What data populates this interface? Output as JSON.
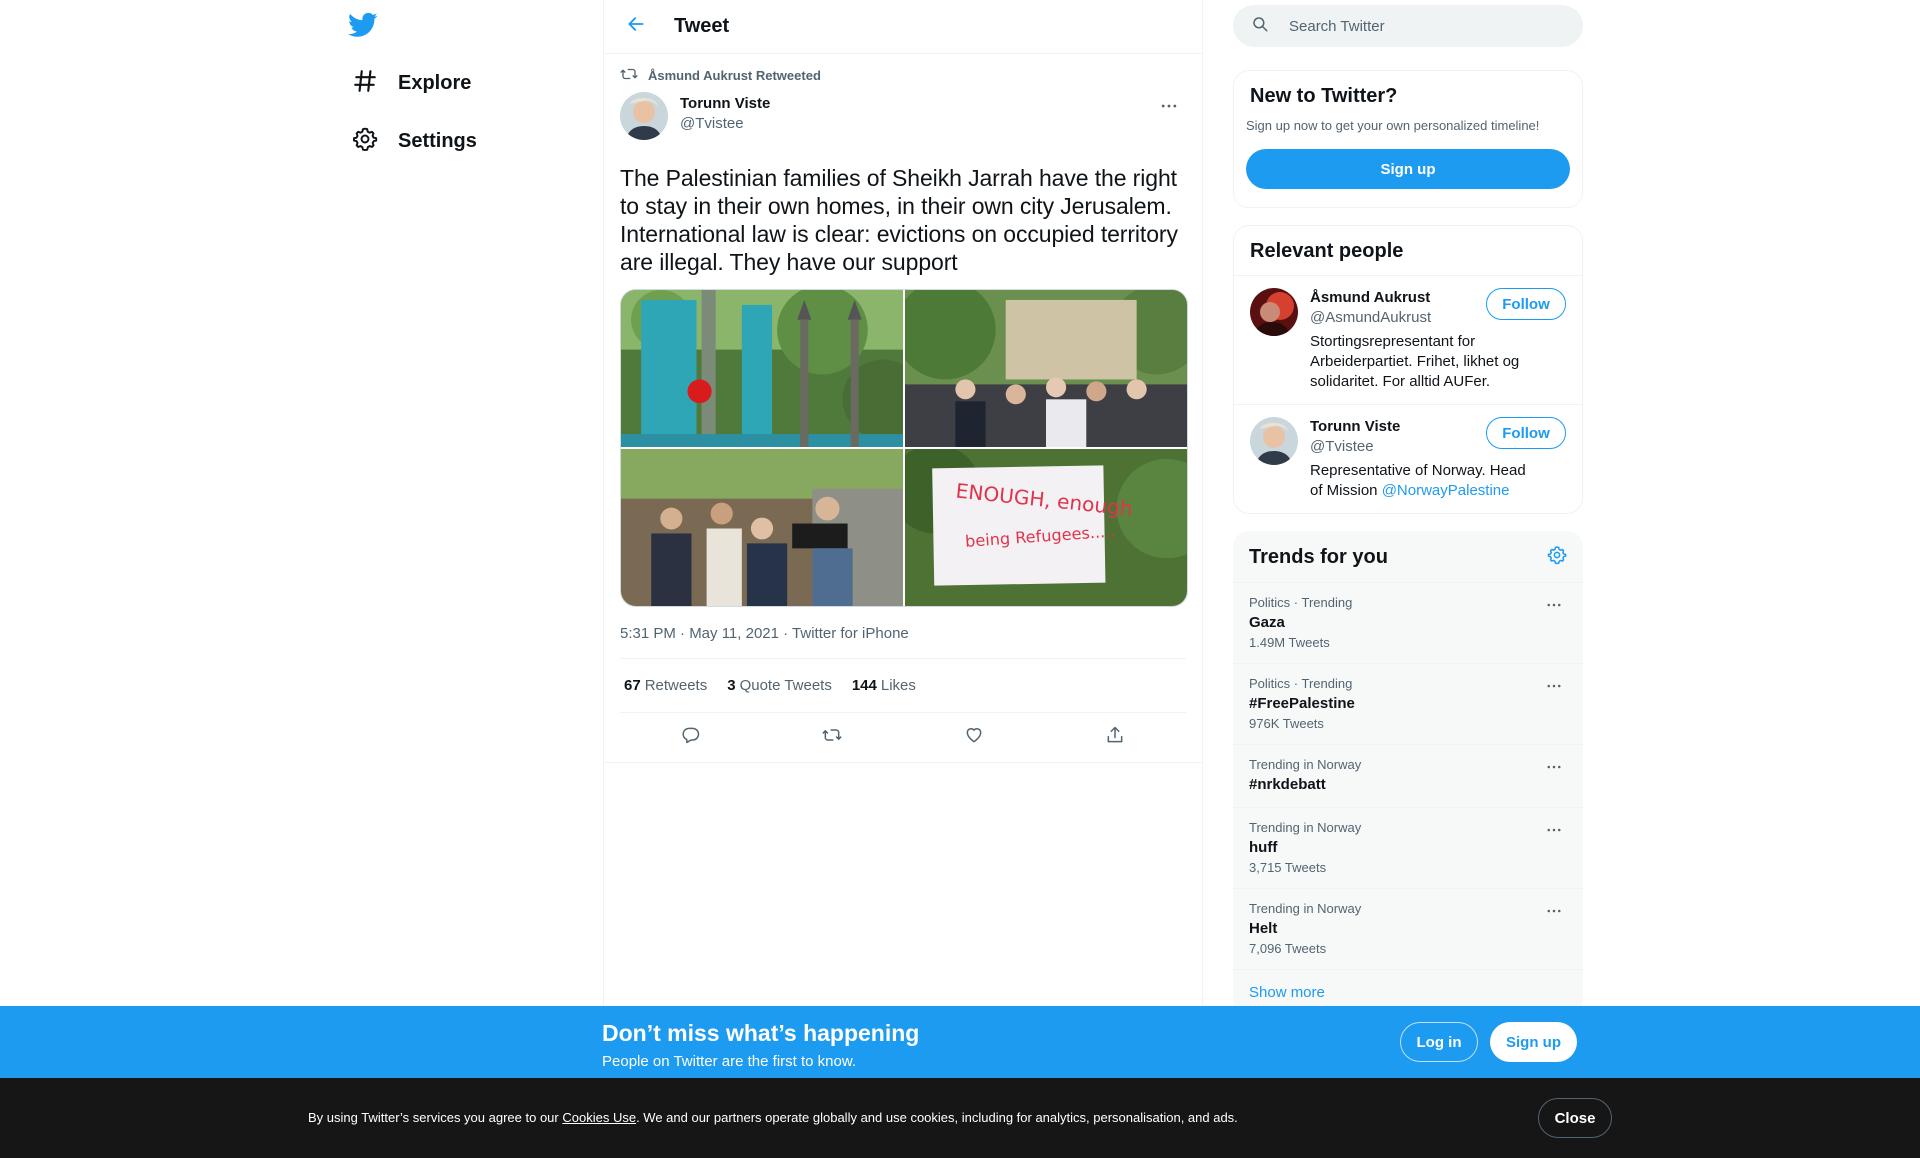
{
  "colors": {
    "accent": "#1d9bf0",
    "text": "#0f1419",
    "secondary": "#536471",
    "cookie_bg": "#161616"
  },
  "nav": {
    "logo_icon": "twitter-bird-icon",
    "items": [
      {
        "label": "Explore",
        "icon": "hashtag-icon"
      },
      {
        "label": "Settings",
        "icon": "gear-icon"
      }
    ]
  },
  "header": {
    "title": "Tweet",
    "back_icon": "arrow-left-icon"
  },
  "tweet": {
    "retweeted_by": "Åsmund Aukrust Retweeted",
    "author_name": "Torunn Viste",
    "author_handle": "@Tvistee",
    "text": "The Palestinian families of Sheikh Jarrah have the right to stay in their own homes, in their own city Jerusalem. International law is clear: evictions on occupied territory are illegal. They have our support",
    "photo_sign_text": [
      "ENOUGH, enough",
      "being Refugees....."
    ],
    "meta": "5:31 PM · May 11, 2021 · Twitter for iPhone",
    "stats": [
      {
        "count": "67",
        "label": "Retweets"
      },
      {
        "count": "3",
        "label": "Quote Tweets"
      },
      {
        "count": "144",
        "label": "Likes"
      }
    ]
  },
  "search": {
    "placeholder": "Search Twitter"
  },
  "signup_card": {
    "title": "New to Twitter?",
    "subtitle": "Sign up now to get your own personalized timeline!",
    "button": "Sign up"
  },
  "relevant_people": {
    "title": "Relevant people",
    "people": [
      {
        "name": "Åsmund Aukrust",
        "handle": "@AsmundAukrust",
        "bio": "Stortingsrepresentant for Arbeiderpartiet. Frihet, likhet og solidaritet. For alltid AUFer.",
        "mention": "",
        "button": "Follow"
      },
      {
        "name": "Torunn Viste",
        "handle": "@Tvistee",
        "bio": "Representative of Norway. Head of Mission ",
        "mention": "@NorwayPalestine",
        "button": "Follow"
      }
    ]
  },
  "trends": {
    "title": "Trends for you",
    "items": [
      {
        "context": "Politics · Trending",
        "name": "Gaza",
        "count": "1.49M Tweets"
      },
      {
        "context": "Politics · Trending",
        "name": "#FreePalestine",
        "count": "976K Tweets"
      },
      {
        "context": "Trending in Norway",
        "name": "#nrkdebatt",
        "count": ""
      },
      {
        "context": "Trending in Norway",
        "name": "huff",
        "count": "3,715 Tweets"
      },
      {
        "context": "Trending in Norway",
        "name": "Helt",
        "count": "7,096 Tweets"
      }
    ],
    "show_more": "Show more"
  },
  "bottom_bar": {
    "title": "Don’t miss what’s happening",
    "subtitle": "People on Twitter are the first to know.",
    "login": "Log in",
    "signup": "Sign up"
  },
  "cookie": {
    "text_before": "By using Twitter’s services you agree to our ",
    "link": "Cookies Use",
    "text_after": ". We and our partners operate globally and use cookies, including for analytics, personalisation, and ads.",
    "close": "Close"
  }
}
